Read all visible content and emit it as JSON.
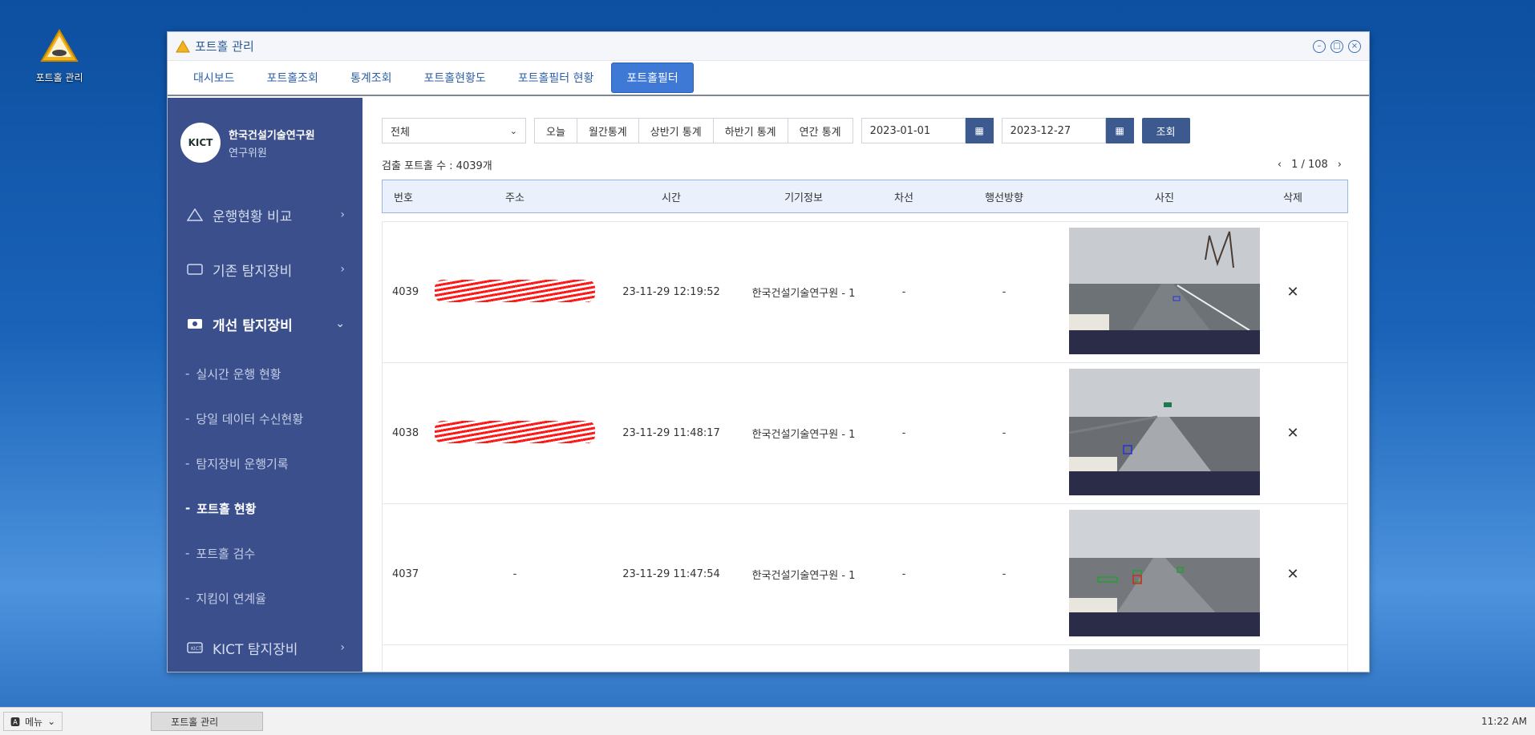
{
  "desktop": {
    "icon_label": "포트홀 관리"
  },
  "window": {
    "title": "포트홀 관리"
  },
  "tabs": [
    {
      "label": "대시보드"
    },
    {
      "label": "포트홀조회"
    },
    {
      "label": "통계조회"
    },
    {
      "label": "포트홀현황도"
    },
    {
      "label": "포트홀필터 현황"
    },
    {
      "label": "포트홀필터"
    }
  ],
  "sidebar": {
    "logo_text": "KICT",
    "org": "한국건설기술연구원",
    "role": "연구위원",
    "groups": [
      {
        "label": "운행현황 비교"
      },
      {
        "label": "기존 탐지장비"
      },
      {
        "label": "개선 탐지장비"
      },
      {
        "label": "KICT 탐지장비"
      }
    ],
    "sub_items": [
      {
        "label": "실시간 운행 현황"
      },
      {
        "label": "당일 데이터 수신현황"
      },
      {
        "label": "탐지장비 운행기록"
      },
      {
        "label": "포트홀 현황"
      },
      {
        "label": "포트홀 검수"
      },
      {
        "label": "지킴이 연계율"
      }
    ]
  },
  "filters": {
    "select_value": "전체",
    "periods": [
      "오늘",
      "월간통계",
      "상반기 통계",
      "하반기 통계",
      "연간 통계"
    ],
    "start_date": "2023-01-01",
    "end_date": "2023-12-27",
    "search_label": "조회"
  },
  "summary": {
    "count_text": "검출 포트홀 수 : 4039개",
    "page_text": "1 / 108"
  },
  "table": {
    "headers": [
      "번호",
      "주소",
      "시간",
      "기기정보",
      "차선",
      "행선방향",
      "사진",
      "삭제"
    ],
    "rows": [
      {
        "no": "4039",
        "address": "",
        "time": "23-11-29 12:19:52",
        "device": "한국건설기술연구원 - 1",
        "lane": "-",
        "direction": "-"
      },
      {
        "no": "4038",
        "address": "",
        "time": "23-11-29 11:48:17",
        "device": "한국건설기술연구원 - 1",
        "lane": "-",
        "direction": "-"
      },
      {
        "no": "4037",
        "address": "-",
        "time": "23-11-29 11:47:54",
        "device": "한국건설기술연구원 - 1",
        "lane": "-",
        "direction": "-"
      }
    ]
  },
  "taskbar": {
    "menu_label": "메뉴",
    "app_label": "포트홀 관리",
    "clock": "11:22 AM"
  }
}
